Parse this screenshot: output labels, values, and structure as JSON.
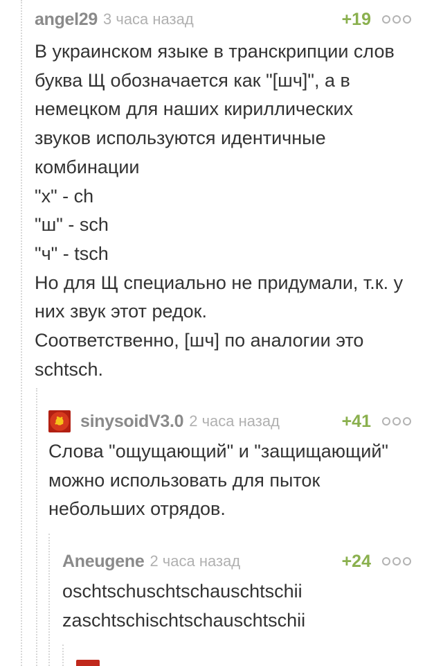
{
  "comments": [
    {
      "author": "angel29",
      "time": "3 часа назад",
      "rating": "+19",
      "lines": [
        "В украинском языке в транскрипции слов",
        "буква Щ обозначается как \"[шч]\", а в",
        "немецком для наших кириллических",
        "звуков используются идентичные",
        "комбинации",
        "\"х\" - ch",
        "\"ш\" - sch",
        "\"ч\" - tsch",
        "Но для Щ специально не придумали, т.к. у",
        "них звук этот редок.",
        "Соответственно, [шч] по аналогии это",
        "schtsch."
      ]
    },
    {
      "author": "sinysoidV3.0",
      "time": "2 часа назад",
      "rating": "+41",
      "lines": [
        "Слова \"ощущающий\" и \"защищающий\"",
        "можно использовать для пыток",
        "небольших отрядов."
      ]
    },
    {
      "author": "Aneugene",
      "time": "2 часа назад",
      "rating": "+24",
      "lines": [
        "oschtschuschtschauschtschii",
        "zaschtschischtschauschtschii"
      ]
    }
  ],
  "icons": {
    "more": "more-dots-icon",
    "avatar": "avatar-icon"
  },
  "colors": {
    "rating": "#8ab04e",
    "author": "#8a8a8a",
    "time": "#b0b0b0",
    "text": "#333333",
    "thread_line": "#d7d7d7"
  }
}
